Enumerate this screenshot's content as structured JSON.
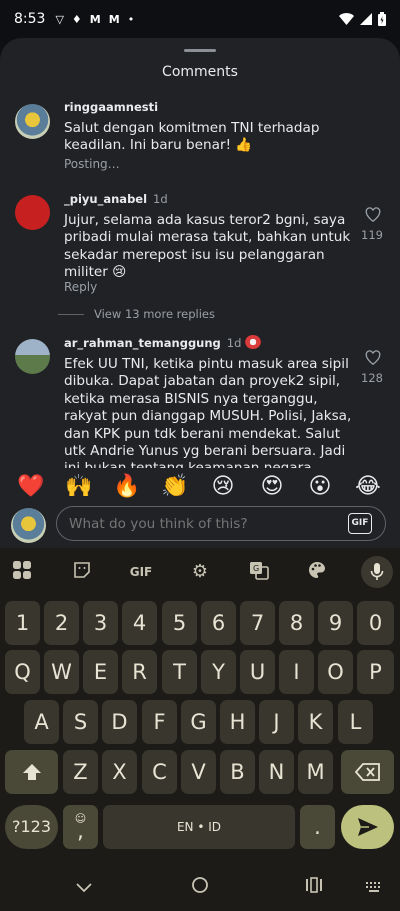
{
  "status_bar": {
    "time": "8:53",
    "left_icons": [
      "vpn-icon",
      "notification-icon",
      "gmail-icon",
      "gmail-icon",
      "dot-icon"
    ],
    "right_icons": [
      "wifi-icon",
      "signal-icon",
      "battery-icon"
    ]
  },
  "sheet": {
    "title": "Comments"
  },
  "comments": [
    {
      "username": "ringgaamnesti",
      "time_ago": "",
      "text": "Salut dengan komitmen TNI terhadap keadilan. Ini baru benar! 👍",
      "meta": "Posting…",
      "likes": ""
    },
    {
      "username": "_piyu_anabel",
      "time_ago": "1d",
      "text": "Jujur, selama ada kasus teror2 bgni, saya pribadi mulai merasa takut, bahkan untuk sekadar merepost isu isu pelanggaran militer 😢",
      "meta": "Reply",
      "likes": "119",
      "view_more": "View 13 more replies"
    },
    {
      "username": "ar_rahman_temanggung",
      "time_ago": "1d",
      "text": "Efek UU TNI, ketika pintu masuk area sipil dibuka. Dapat jabatan dan proyek2 sipil, ketika merasa BISNIS nya terganggu, rakyat pun dianggap MUSUH. Polisi, Jaksa, dan KPK pun tdk berani mendekat. Salut utk Andrie Yunus yg berani bersuara. Jadi ini bukan tentang keamanan negara.",
      "meta": "",
      "likes": "128"
    }
  ],
  "reactions": [
    "❤️",
    "🙌",
    "🔥",
    "👏",
    "😢",
    "😍",
    "😮",
    "😂"
  ],
  "composer": {
    "placeholder": "What do you think of this?",
    "gif_label": "GIF"
  },
  "keyboard": {
    "toolbar": {
      "gif": "GIF"
    },
    "row_numbers": [
      "1",
      "2",
      "3",
      "4",
      "5",
      "6",
      "7",
      "8",
      "9",
      "0"
    ],
    "row_top": [
      "Q",
      "W",
      "E",
      "R",
      "T",
      "Y",
      "U",
      "I",
      "O",
      "P"
    ],
    "row_middle": [
      "A",
      "S",
      "D",
      "F",
      "G",
      "H",
      "J",
      "K",
      "L"
    ],
    "row_bottom": [
      "Z",
      "X",
      "C",
      "V",
      "B",
      "N",
      "M"
    ],
    "symbols_label": "?123",
    "comma": ",",
    "space_label": "EN • ID",
    "period": "."
  },
  "colors": {
    "sheet_bg": "#202226",
    "keyboard_bg": "#1c1b17",
    "key_bg": "#38362d",
    "action_key": "#bcc27e"
  }
}
